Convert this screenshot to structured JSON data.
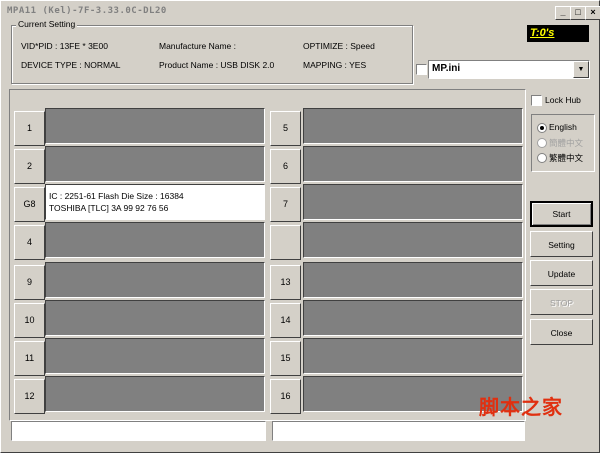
{
  "window": {
    "title": "MPA11 (Kel)-7F-3.33.0C-DL20",
    "minimize": "_",
    "maximize": "□",
    "close": "×"
  },
  "current_setting": {
    "legend": "Current Setting",
    "vid_pid": "VID*PID : 13FE * 3E00",
    "manufacture_name": "Manufacture Name :",
    "optimize": "OPTIMIZE : Speed",
    "device_type": "DEVICE TYPE : NORMAL",
    "product_name": "Product Name : USB DISK 2.0",
    "mapping": "MAPPING : YES"
  },
  "timer": "T:0's",
  "ini_combo": {
    "value": "MP.ini",
    "arrow": "▼"
  },
  "lock_hub": "Lock Hub",
  "languages": [
    {
      "label": "English",
      "selected": true,
      "disabled": false
    },
    {
      "label": "簡體中文",
      "selected": false,
      "disabled": true
    },
    {
      "label": "繁體中文",
      "selected": false,
      "disabled": false
    }
  ],
  "actions": {
    "start": "Start",
    "setting": "Setting",
    "update": "Update",
    "stop": "STOP",
    "close": "Close"
  },
  "slots": {
    "s1": "1",
    "s2": "2",
    "s3": "G8",
    "s4": "4",
    "s5": "5",
    "s6": "6",
    "s7": "7",
    "s8": "",
    "s9": "9",
    "s10": "10",
    "s11": "11",
    "s12": "12",
    "s13": "13",
    "s14": "14",
    "s15": "15",
    "s16": "16"
  },
  "active_slot_info": {
    "line1": "IC : 2251-61  Flash Die Size : 16384",
    "line2": "TOSHIBA [TLC] 3A 99 92 76 56"
  },
  "watermark": "脚本之家",
  "colors": {
    "timer_bg": "#000000",
    "timer_fg": "#ffff00",
    "slot_idle": "#808080",
    "slot_active": "#ffffff"
  }
}
